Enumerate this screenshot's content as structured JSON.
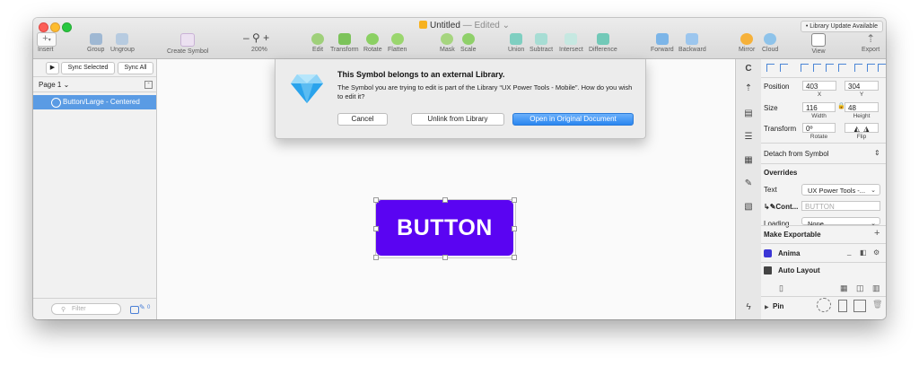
{
  "window": {
    "doc_title": "Untitled",
    "doc_status": "— Edited",
    "library_update": "Library Update Available"
  },
  "toolbar": {
    "insert": "Insert",
    "group": "Group",
    "ungroup": "Ungroup",
    "create_symbol": "Create Symbol",
    "zoom": "200%",
    "edit": "Edit",
    "transform": "Transform",
    "rotate": "Rotate",
    "flatten": "Flatten",
    "mask": "Mask",
    "scale": "Scale",
    "union": "Union",
    "subtract": "Subtract",
    "intersect": "Intersect",
    "difference": "Difference",
    "forward": "Forward",
    "backward": "Backward",
    "mirror": "Mirror",
    "cloud": "Cloud",
    "view": "View",
    "export": "Export"
  },
  "left_panel": {
    "sync_selected": "Sync Selected",
    "sync_all": "Sync All",
    "page": "Page 1",
    "layer": "Button/Large - Centered",
    "filter_placeholder": "Filter",
    "count": "0"
  },
  "dialog": {
    "title": "This Symbol belongs to an external Library.",
    "message": "The Symbol you are trying to edit is part of the Library “UX Power Tools - Mobile”. How do you wish to edit it?",
    "cancel": "Cancel",
    "unlink": "Unlink from Library",
    "open": "Open in Original Document"
  },
  "canvas": {
    "button_text": "BUTTON"
  },
  "inspector": {
    "position_label": "Position",
    "x": "403",
    "y": "304",
    "x_label": "X",
    "y_label": "Y",
    "size_label": "Size",
    "width": "116",
    "height": "48",
    "width_label": "Width",
    "height_label": "Height",
    "transform_label": "Transform",
    "rotate_value": "0º",
    "rotate_label": "Rotate",
    "flip_label": "Flip",
    "detach": "Detach from Symbol",
    "overrides": "Overrides",
    "text_label": "Text",
    "text_value": "UX Power Tools -...",
    "content_label": "Cont...",
    "content_placeholder": "BUTTON",
    "loading_label": "Loading",
    "loading_value": "None",
    "make_exportable": "Make Exportable",
    "anima": "Anima",
    "auto_layout": "Auto Layout",
    "pin": "Pin"
  },
  "colors": {
    "button_fill": "#5a04f2",
    "selection": "#5a9be4",
    "primary_button": "#2a86f0"
  }
}
